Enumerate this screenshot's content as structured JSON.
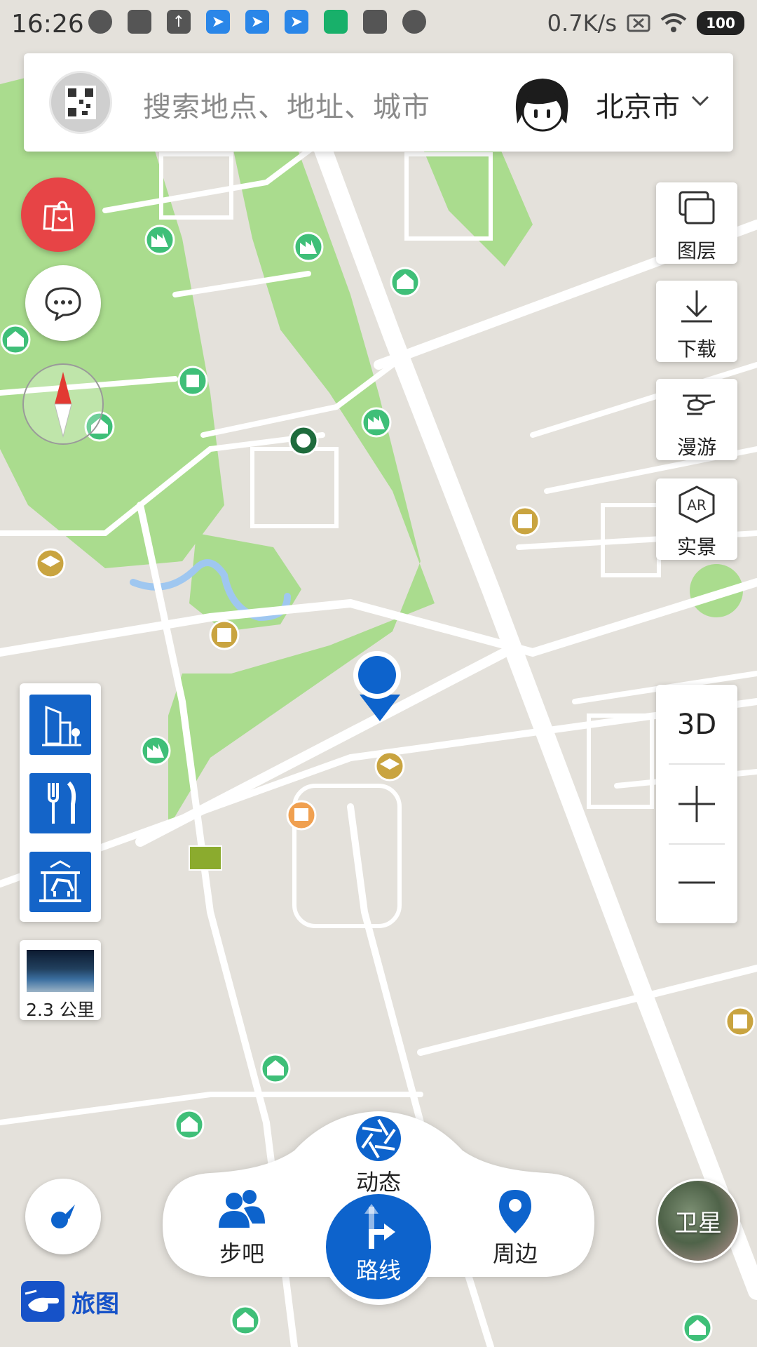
{
  "status_bar": {
    "time": "16:26",
    "speed": "0.7K/s",
    "battery": "100",
    "notification_icons": [
      "circle-icon",
      "mi-store-icon",
      "upload-icon",
      "paper-plane-icon",
      "paper-plane-icon",
      "paper-plane-icon",
      "green-app-icon",
      "trash-icon",
      "circle-icon"
    ]
  },
  "search": {
    "placeholder": "搜索地点、地址、城市",
    "city": "北京市"
  },
  "tools": {
    "layers": "图层",
    "download": "下载",
    "roam": "漫游",
    "ar": "实景",
    "ar_badge": "AR"
  },
  "zoom": {
    "mode": "3D"
  },
  "thumbnail": {
    "distance": "2.3 公里"
  },
  "bottom_nav": {
    "dynamic": "动态",
    "buddy": "步吧",
    "route": "路线",
    "nearby": "周边"
  },
  "satellite": "卫星",
  "app": {
    "logo_text": "旅图"
  },
  "colors": {
    "accent": "#0d63cc",
    "shop": "#e74446",
    "map_green": "#a9dc8d",
    "map_ground": "#e4e1db"
  }
}
